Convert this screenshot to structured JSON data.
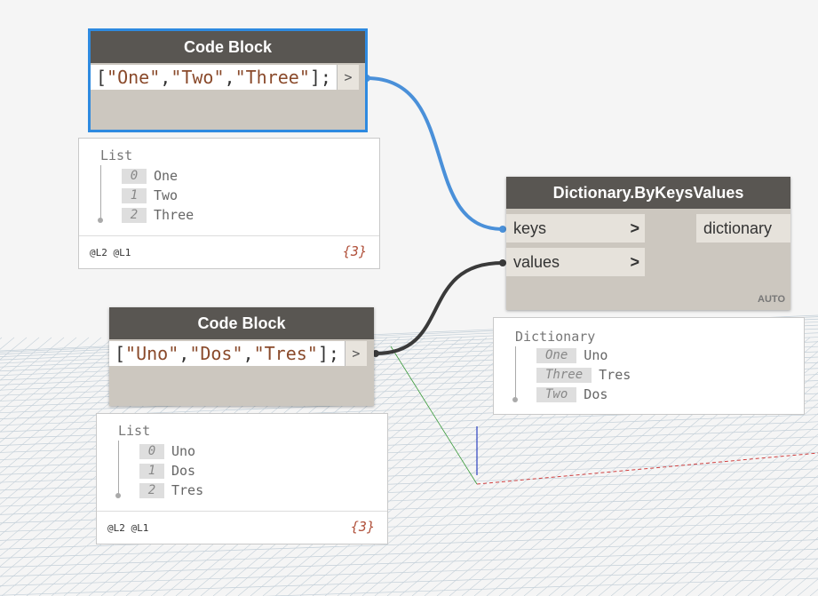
{
  "canvas": {
    "background": "#f5f5f5",
    "grid_color": "#c3cfd8"
  },
  "code_block_1": {
    "title": "Code Block",
    "code": {
      "open": "[",
      "a": "\"One\"",
      "c1": ",",
      "b": "\"Two\"",
      "c2": ",",
      "c": "\"Three\"",
      "close": "];"
    },
    "out_port": ">",
    "preview": {
      "title": "List",
      "items": [
        {
          "index": "0",
          "value": "One"
        },
        {
          "index": "1",
          "value": "Two"
        },
        {
          "index": "2",
          "value": "Three"
        }
      ],
      "levels": "@L2 @L1",
      "count": "{3}"
    }
  },
  "code_block_2": {
    "title": "Code Block",
    "code": {
      "open": "[",
      "a": "\"Uno\"",
      "c1": ",",
      "b": "\"Dos\"",
      "c2": ",",
      "c": "\"Tres\"",
      "close": "];"
    },
    "out_port": ">",
    "preview": {
      "title": "List",
      "items": [
        {
          "index": "0",
          "value": "Uno"
        },
        {
          "index": "1",
          "value": "Dos"
        },
        {
          "index": "2",
          "value": "Tres"
        }
      ],
      "levels": "@L2 @L1",
      "count": "{3}"
    }
  },
  "dictionary_node": {
    "title": "Dictionary.ByKeysValues",
    "inputs": [
      {
        "label": "keys",
        "chevron": ">"
      },
      {
        "label": "values",
        "chevron": ">"
      }
    ],
    "output": "dictionary",
    "lacing": "AUTO",
    "preview": {
      "title": "Dictionary",
      "items": [
        {
          "key": "One",
          "value": "Uno"
        },
        {
          "key": "Three",
          "value": "Tres"
        },
        {
          "key": "Two",
          "value": "Dos"
        }
      ]
    }
  },
  "colors": {
    "wire_selected": "#4a90d9",
    "wire_default": "#3a3a3a",
    "header": "#595652",
    "node_body": "#ccc7bf"
  }
}
